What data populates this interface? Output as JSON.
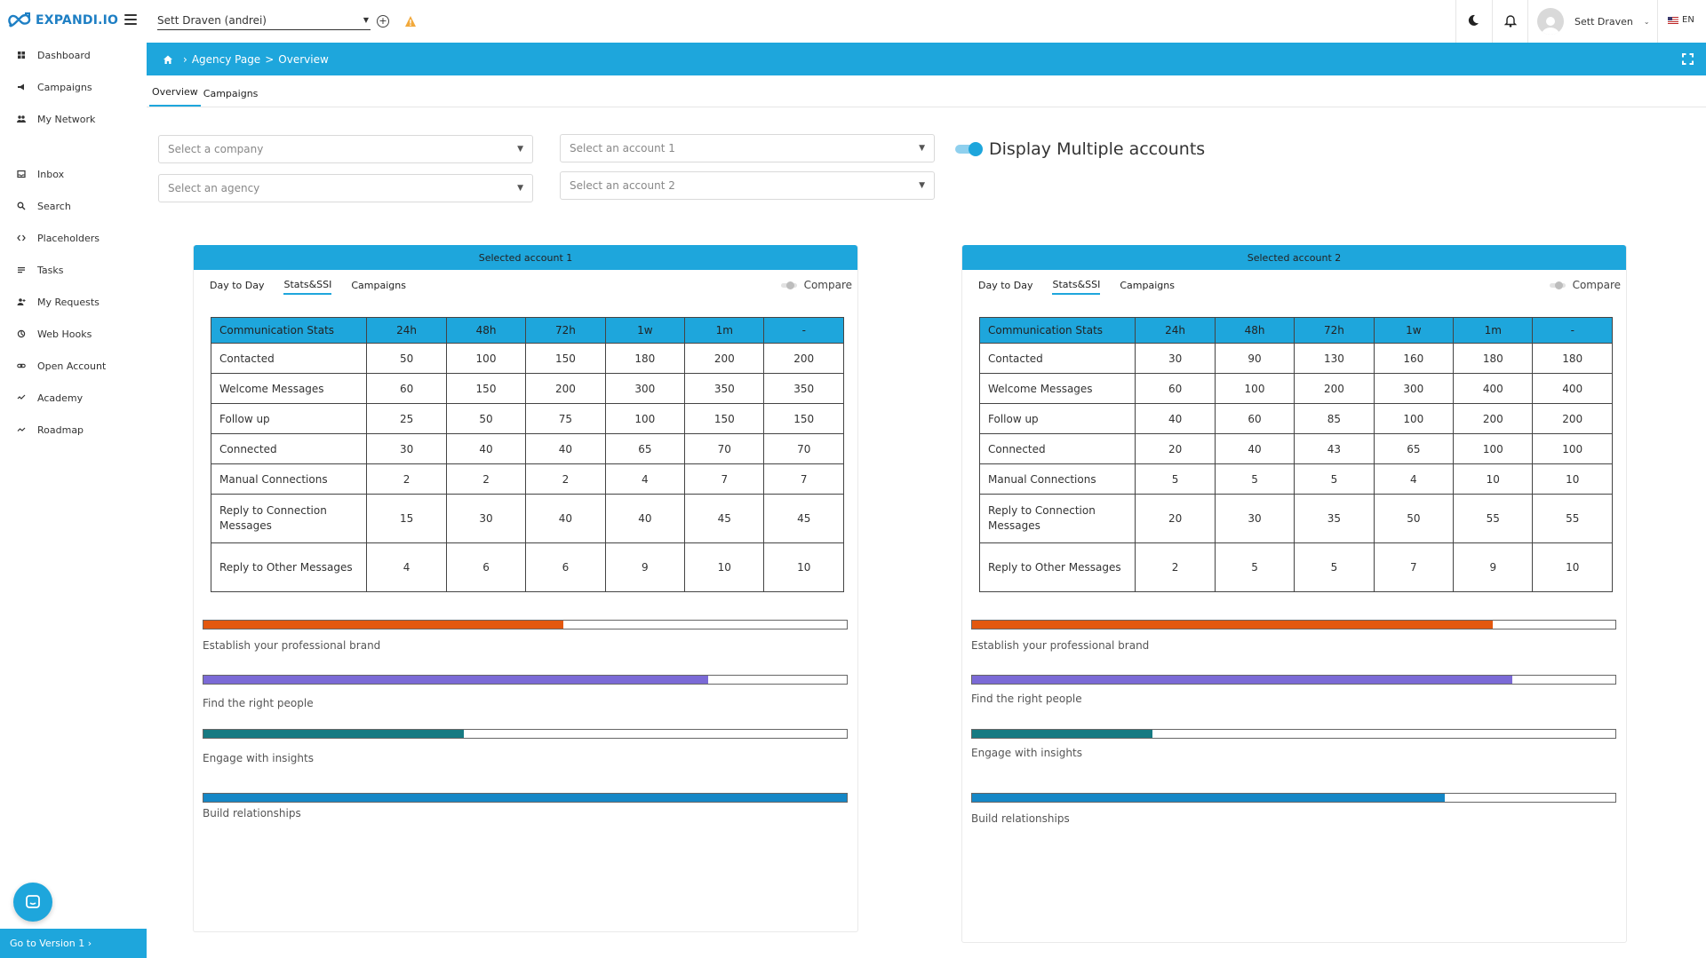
{
  "app": {
    "logo_text": "EXPANDI.IO",
    "accent": "#1ea6dc"
  },
  "sidebar": {
    "items_top": [
      {
        "label": "Dashboard",
        "icon": "dashboard-icon"
      },
      {
        "label": "Campaigns",
        "icon": "megaphone-icon"
      },
      {
        "label": "My Network",
        "icon": "network-icon"
      }
    ],
    "items_bottom": [
      {
        "label": "Inbox",
        "icon": "inbox-icon"
      },
      {
        "label": "Search",
        "icon": "search-icon"
      },
      {
        "label": "Placeholders",
        "icon": "code-icon"
      },
      {
        "label": "Tasks",
        "icon": "tasks-icon"
      },
      {
        "label": "My Requests",
        "icon": "user-plus-icon"
      },
      {
        "label": "Web Hooks",
        "icon": "webhook-icon"
      },
      {
        "label": "Open Account",
        "icon": "link-icon"
      },
      {
        "label": "Academy",
        "icon": "academy-icon"
      },
      {
        "label": "Roadmap",
        "icon": "roadmap-icon"
      }
    ],
    "go_version": "Go to Version 1 ›"
  },
  "topbar": {
    "account": "Sett Draven (andrei)",
    "user_name": "Sett Draven",
    "lang": "EN"
  },
  "breadcrumb": {
    "page": "Agency Page",
    "sub": "Overview"
  },
  "page_tabs": [
    "Overview",
    "Campaigns"
  ],
  "filters": {
    "company_placeholder": "Select a company",
    "agency_placeholder": "Select an agency",
    "account1_placeholder": "Select an account 1",
    "account2_placeholder": "Select an account 2",
    "multi_label": "Display Multiple accounts",
    "multi_enabled": true
  },
  "panel_common": {
    "tabs": [
      "Day to Day",
      "Stats&SSI",
      "Campaigns"
    ],
    "active_tab": "Stats&SSI",
    "compare_label": "Compare",
    "columns": [
      "Communication Stats",
      "24h",
      "48h",
      "72h",
      "1w",
      "1m",
      "-"
    ],
    "row_labels": [
      "Contacted",
      "Welcome Messages",
      "Follow up",
      "Connected",
      "Manual Connections",
      "Reply to Connection Messages",
      "Reply to Other Messages"
    ],
    "ssi_labels": [
      "Establish your professional brand",
      "Find the right people",
      "Engage with insights",
      "Build relationships"
    ],
    "ssi_colors": [
      "#e3580f",
      "#7b6ad6",
      "#167a82",
      "#1587c6"
    ]
  },
  "panels": [
    {
      "title": "Selected account 1",
      "rows": [
        [
          50,
          100,
          150,
          180,
          200,
          200
        ],
        [
          60,
          150,
          200,
          300,
          350,
          350
        ],
        [
          25,
          50,
          75,
          100,
          150,
          150
        ],
        [
          30,
          40,
          40,
          65,
          70,
          70
        ],
        [
          2,
          2,
          2,
          4,
          7,
          7
        ],
        [
          15,
          30,
          40,
          40,
          45,
          45
        ],
        [
          4,
          6,
          6,
          9,
          10,
          10
        ]
      ],
      "ssi_fractions": [
        0.56,
        0.785,
        0.405,
        1.0
      ]
    },
    {
      "title": "Selected account 2",
      "rows": [
        [
          30,
          90,
          130,
          160,
          180,
          180
        ],
        [
          60,
          100,
          200,
          300,
          400,
          400
        ],
        [
          40,
          60,
          85,
          100,
          200,
          200
        ],
        [
          20,
          40,
          43,
          65,
          100,
          100
        ],
        [
          5,
          5,
          5,
          4,
          10,
          10
        ],
        [
          20,
          30,
          35,
          50,
          55,
          55
        ],
        [
          2,
          5,
          5,
          7,
          9,
          10
        ]
      ],
      "ssi_fractions": [
        0.81,
        0.84,
        0.28,
        0.735
      ]
    }
  ]
}
